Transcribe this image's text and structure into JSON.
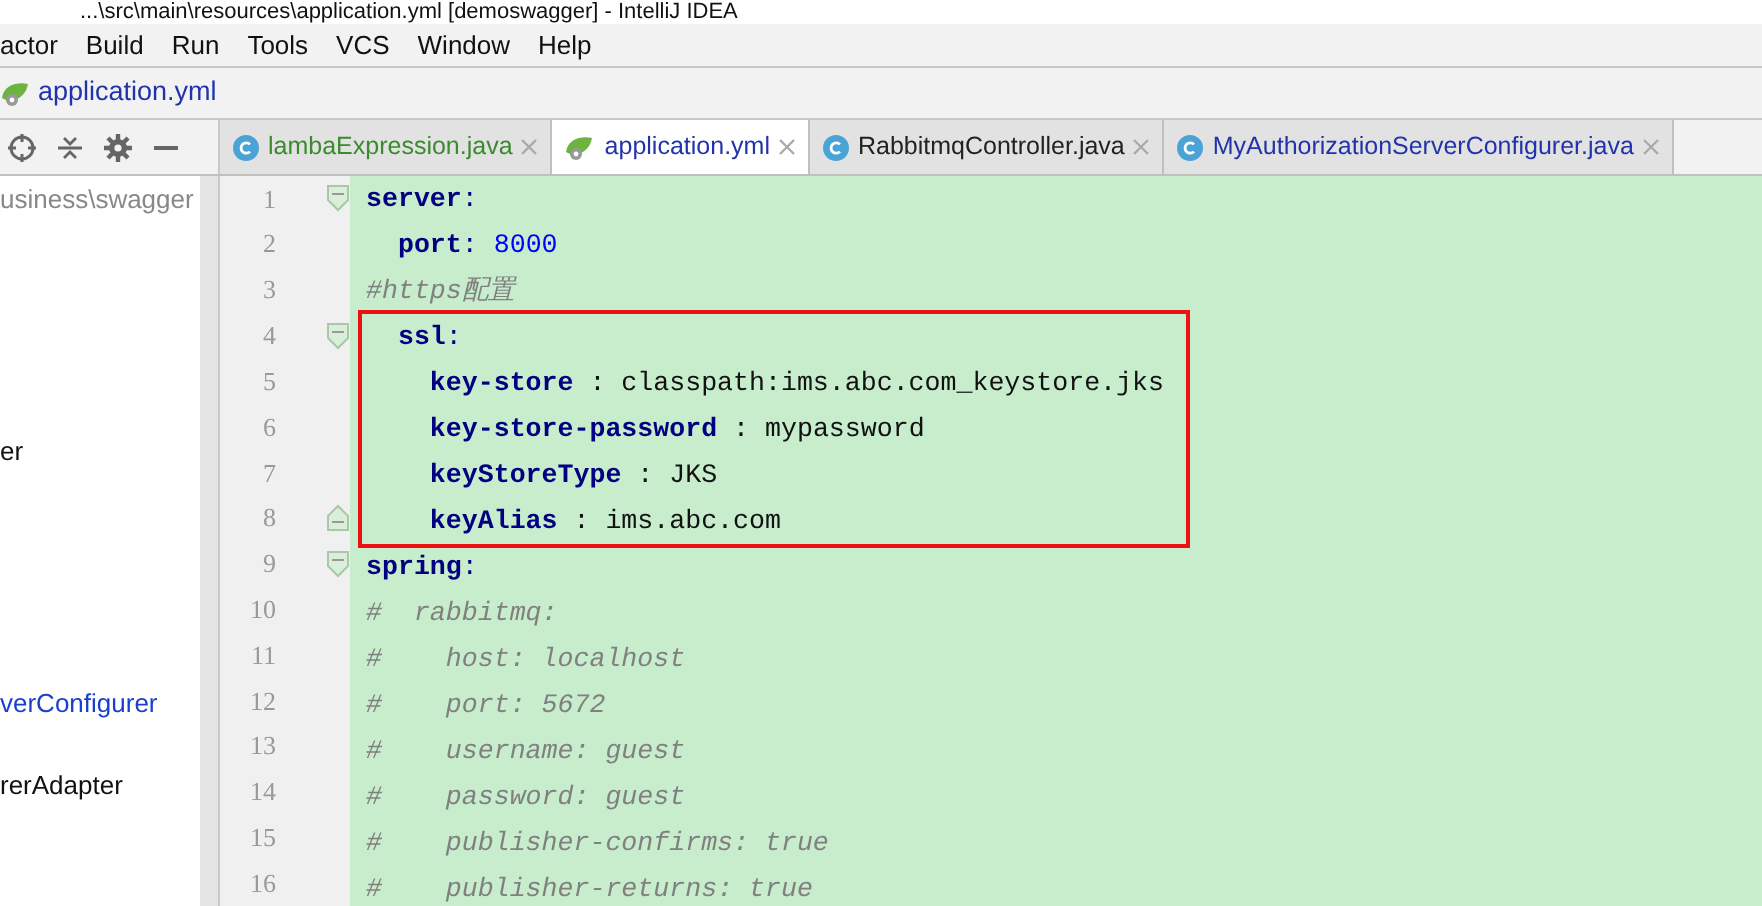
{
  "window": {
    "title": "...\\src\\main\\resources\\application.yml [demoswagger] - IntelliJ IDEA"
  },
  "menu": [
    "actor",
    "Build",
    "Run",
    "Tools",
    "VCS",
    "Window",
    "Help"
  ],
  "breadcrumb": {
    "file": "application.yml"
  },
  "tabs": [
    {
      "label": "lambaExpression.java",
      "kind": "java",
      "selected": false,
      "color": "#3a8a2e"
    },
    {
      "label": "application.yml",
      "kind": "yml",
      "selected": true,
      "color": "#2233aa"
    },
    {
      "label": "RabbitmqController.java",
      "kind": "java",
      "selected": false,
      "color": "#222222"
    },
    {
      "label": "MyAuthorizationServerConfigurer.java",
      "kind": "java",
      "selected": false,
      "color": "#2233aa"
    }
  ],
  "sidebar": {
    "items": [
      {
        "label": "usiness\\swagger",
        "color": "#888888"
      },
      {
        "label": "er",
        "color": "#111111"
      },
      {
        "label": "verConfigurer",
        "color": "#1a3fcc"
      },
      {
        "label": "rerAdapter",
        "color": "#111111"
      }
    ]
  },
  "editor": {
    "lines": [
      {
        "number": "1",
        "fold_open": true,
        "fold_close": false,
        "boxed": false,
        "tokens": [
          {
            "kind": "key",
            "text": "server"
          },
          {
            "kind": "punct",
            "text": ":"
          }
        ]
      },
      {
        "number": "2",
        "fold_open": false,
        "fold_close": false,
        "boxed": false,
        "tokens": [
          {
            "kind": "key",
            "text": "  port"
          },
          {
            "kind": "punct",
            "text": ": "
          },
          {
            "kind": "number",
            "text": "8000"
          }
        ]
      },
      {
        "number": "3",
        "fold_open": false,
        "fold_close": false,
        "boxed": false,
        "tokens": [
          {
            "kind": "comment",
            "text": "#https配置"
          }
        ]
      },
      {
        "number": "4",
        "fold_open": true,
        "fold_close": false,
        "boxed": true,
        "tokens": [
          {
            "kind": "key",
            "text": "  ssl"
          },
          {
            "kind": "punct",
            "text": ":"
          }
        ]
      },
      {
        "number": "5",
        "fold_open": false,
        "fold_close": false,
        "boxed": true,
        "tokens": [
          {
            "kind": "key",
            "text": "    key-store"
          },
          {
            "kind": "value",
            "text": " : classpath:ims.abc.com_keystore.jks"
          }
        ]
      },
      {
        "number": "6",
        "fold_open": false,
        "fold_close": false,
        "boxed": true,
        "tokens": [
          {
            "kind": "key",
            "text": "    key-store-password"
          },
          {
            "kind": "value",
            "text": " : mypassword"
          }
        ]
      },
      {
        "number": "7",
        "fold_open": false,
        "fold_close": false,
        "boxed": true,
        "tokens": [
          {
            "kind": "key",
            "text": "    keyStoreType"
          },
          {
            "kind": "value",
            "text": " : JKS"
          }
        ]
      },
      {
        "number": "8",
        "fold_open": false,
        "fold_close": true,
        "boxed": true,
        "tokens": [
          {
            "kind": "key",
            "text": "    keyAlias"
          },
          {
            "kind": "value",
            "text": " : ims.abc.com"
          }
        ]
      },
      {
        "number": "9",
        "fold_open": true,
        "fold_close": false,
        "boxed": false,
        "tokens": [
          {
            "kind": "key",
            "text": "spring"
          },
          {
            "kind": "punct",
            "text": ":"
          }
        ]
      },
      {
        "number": "10",
        "fold_open": false,
        "fold_close": false,
        "boxed": false,
        "tokens": [
          {
            "kind": "comment",
            "text": "#  rabbitmq:"
          }
        ]
      },
      {
        "number": "11",
        "fold_open": false,
        "fold_close": false,
        "boxed": false,
        "tokens": [
          {
            "kind": "comment",
            "text": "#    host: localhost"
          }
        ]
      },
      {
        "number": "12",
        "fold_open": false,
        "fold_close": false,
        "boxed": false,
        "tokens": [
          {
            "kind": "comment",
            "text": "#    port: 5672"
          }
        ]
      },
      {
        "number": "13",
        "fold_open": false,
        "fold_close": false,
        "boxed": false,
        "tokens": [
          {
            "kind": "comment",
            "text": "#    username: guest"
          }
        ]
      },
      {
        "number": "14",
        "fold_open": false,
        "fold_close": false,
        "boxed": false,
        "tokens": [
          {
            "kind": "comment",
            "text": "#    password: guest"
          }
        ]
      },
      {
        "number": "15",
        "fold_open": false,
        "fold_close": false,
        "boxed": false,
        "tokens": [
          {
            "kind": "comment",
            "text": "#    publisher-confirms: true"
          }
        ]
      },
      {
        "number": "16",
        "fold_open": false,
        "fold_close": false,
        "boxed": false,
        "tokens": [
          {
            "kind": "comment",
            "text": "#    publisher-returns: true"
          }
        ]
      }
    ]
  }
}
